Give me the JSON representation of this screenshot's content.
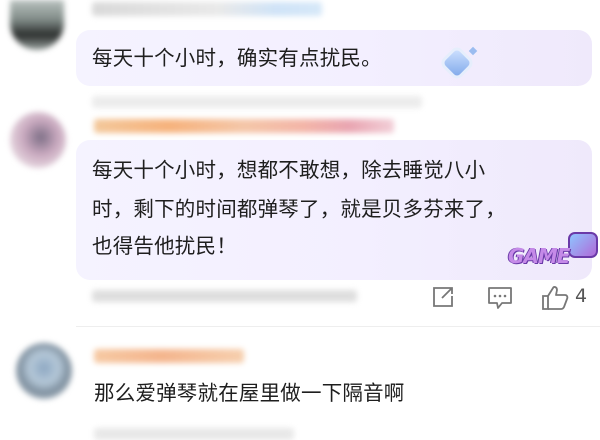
{
  "comments": [
    {
      "text": "每天十个小时，确实有点扰民。"
    },
    {
      "text_lines": [
        "每天十个小时，想都不敢想，除去睡觉八小",
        "时，剩下的时间都弹琴了，就是贝多芬来了，",
        "也得告他扰民！"
      ],
      "badge": "GAME",
      "actions": {
        "like_count": "4"
      }
    },
    {
      "text": "那么爱弹琴就在屋里做一下隔音啊"
    }
  ],
  "icons": {
    "share": "share-icon",
    "comment": "comment-icon",
    "like": "thumbs-up-icon",
    "badge": "diamond-badge-icon"
  },
  "colors": {
    "bubble": "#f3efff",
    "badge_purple": "#b06ad8",
    "badge_blue": "#5aa8e6"
  }
}
